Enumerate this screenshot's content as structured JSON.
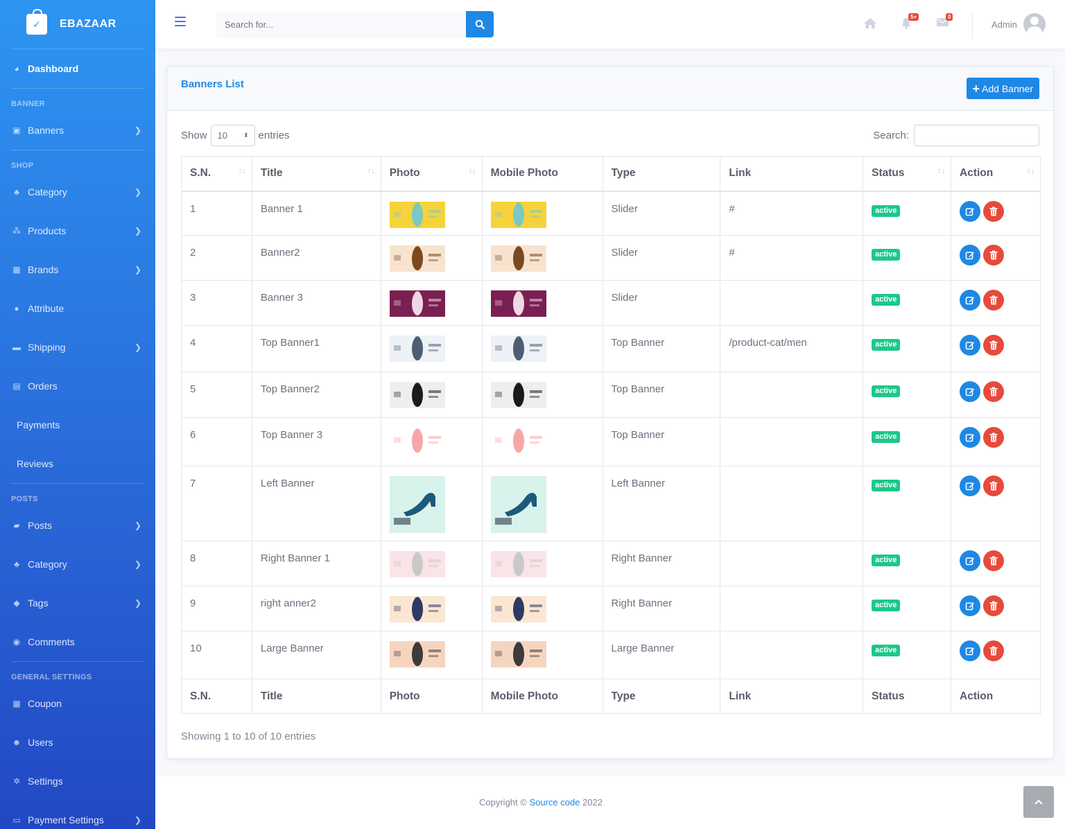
{
  "brand": {
    "name": "EBAZAAR"
  },
  "sidebar": {
    "dashboard": "Dashboard",
    "headings": {
      "banner": "BANNER",
      "shop": "SHOP",
      "posts": "POSTS",
      "general": "GENERAL SETTINGS"
    },
    "items": {
      "banners": "Banners",
      "category": "Category",
      "products": "Products",
      "brands": "Brands",
      "attribute": "Attribute",
      "shipping": "Shipping",
      "orders": "Orders",
      "payments": "Payments",
      "reviews": "Reviews",
      "posts": "Posts",
      "post_category": "Category",
      "tags": "Tags",
      "comments": "Comments",
      "coupon": "Coupon",
      "users": "Users",
      "settings": "Settings",
      "payment_settings": "Payment Settings"
    }
  },
  "topbar": {
    "search_placeholder": "Search for...",
    "alerts_badge": "5+",
    "messages_badge": "0",
    "user_name": "Admin"
  },
  "card": {
    "title": "Banners List",
    "add_button": "Add Banner",
    "show_label": "Show",
    "entries_label": "entries",
    "page_size": "10",
    "search_label": "Search:",
    "info": "Showing 1 to 10 of 10 entries"
  },
  "table": {
    "headers": [
      "S.N.",
      "Title",
      "Photo",
      "Mobile Photo",
      "Type",
      "Link",
      "Status",
      "Action"
    ],
    "rows": [
      {
        "sn": "1",
        "title": "Banner 1",
        "type": "Slider",
        "link": "#",
        "status": "active"
      },
      {
        "sn": "2",
        "title": "Banner2",
        "type": "Slider",
        "link": "#",
        "status": "active"
      },
      {
        "sn": "3",
        "title": "Banner 3",
        "type": "Slider",
        "link": "",
        "status": "active"
      },
      {
        "sn": "4",
        "title": "Top Banner1",
        "type": "Top Banner",
        "link": "/product-cat/men",
        "status": "active"
      },
      {
        "sn": "5",
        "title": "Top Banner2",
        "type": "Top Banner",
        "link": "",
        "status": "active"
      },
      {
        "sn": "6",
        "title": "Top Banner 3",
        "type": "Top Banner",
        "link": "",
        "status": "active"
      },
      {
        "sn": "7",
        "title": "Left Banner",
        "type": "Left Banner",
        "link": "",
        "status": "active"
      },
      {
        "sn": "8",
        "title": "Right Banner 1",
        "type": "Right Banner",
        "link": "",
        "status": "active"
      },
      {
        "sn": "9",
        "title": "right anner2",
        "type": "Right Banner",
        "link": "",
        "status": "active"
      },
      {
        "sn": "10",
        "title": "Large Banner",
        "type": "Large Banner",
        "link": "",
        "status": "active"
      }
    ]
  },
  "footer": {
    "copyright_prefix": "Copyright © ",
    "copyright_link": "Source code",
    "copyright_suffix": " 2022"
  },
  "colors": {
    "primary": "#1e88e5",
    "danger": "#e74a3b",
    "success": "#1cc88a"
  }
}
